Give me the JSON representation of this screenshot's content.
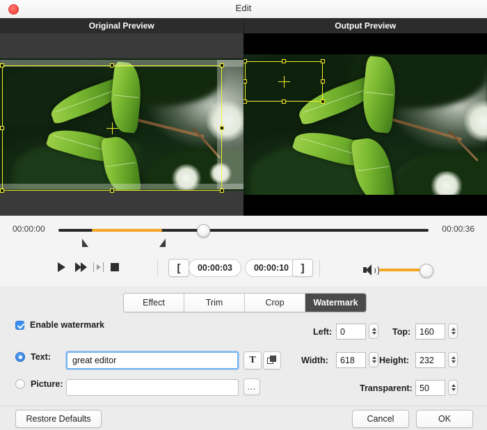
{
  "window": {
    "title": "Edit",
    "close_icon": "close-icon"
  },
  "previews": {
    "original_label": "Original Preview",
    "output_label": "Output Preview"
  },
  "timeline": {
    "start_time": "00:00:00",
    "end_time": "00:00:36",
    "accent_color": "#f5a623",
    "range_start_pct": 9,
    "range_end_pct": 28,
    "playhead_pct": 39
  },
  "transport": {
    "play_icon": "play-icon",
    "fast_forward_icon": "fast-forward-icon",
    "step_icon": "step-frame-icon",
    "stop_icon": "stop-icon",
    "mark_in_icon": "[",
    "mark_out_icon": "]",
    "start_time": "00:00:03",
    "end_time": "00:00:10",
    "volume_icon": "speaker-icon",
    "volume_pct": 100
  },
  "tabs": [
    {
      "label": "Effect",
      "active": false
    },
    {
      "label": "Trim",
      "active": false
    },
    {
      "label": "Crop",
      "active": false
    },
    {
      "label": "Watermark",
      "active": true
    }
  ],
  "watermark": {
    "enable_label": "Enable watermark",
    "enable_checked": true,
    "text_label": "Text:",
    "text_value": "great editor",
    "text_selected": true,
    "font_button_icon": "text-format-icon",
    "font_button_label": "T",
    "layer_button_icon": "layers-icon",
    "picture_label": "Picture:",
    "picture_value": "",
    "picture_selected": false,
    "browse_label": "…",
    "left_label": "Left:",
    "left_value": "0",
    "top_label": "Top:",
    "top_value": "160",
    "width_label": "Width:",
    "width_value": "618",
    "height_label": "Height:",
    "height_value": "232",
    "transparent_label": "Transparent:",
    "transparent_value": "50"
  },
  "footer": {
    "restore_label": "Restore Defaults",
    "cancel_label": "Cancel",
    "ok_label": "OK"
  }
}
